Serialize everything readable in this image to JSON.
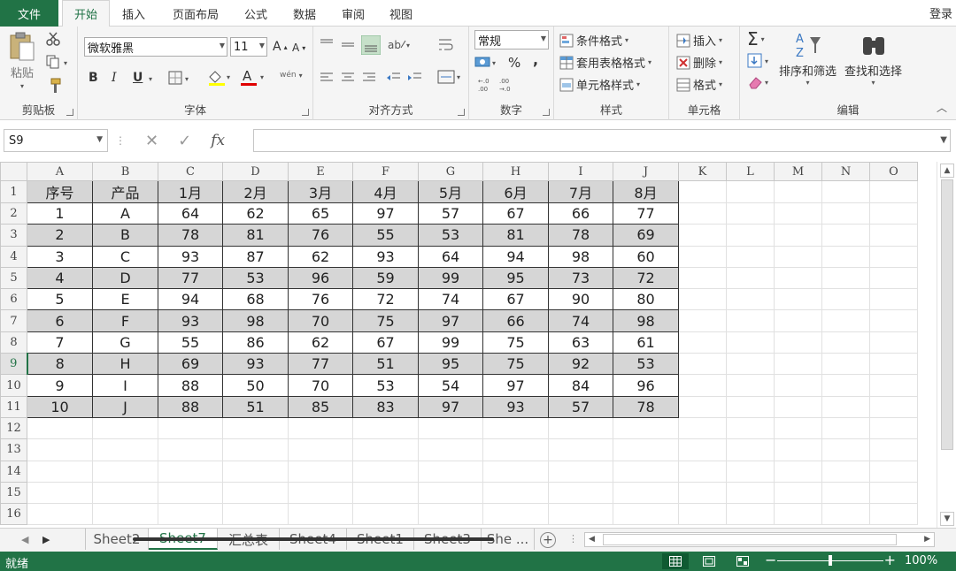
{
  "tabs": {
    "file": "文件",
    "items": [
      "开始",
      "插入",
      "页面布局",
      "公式",
      "数据",
      "审阅",
      "视图"
    ],
    "active": "开始",
    "login": "登录"
  },
  "ribbon": {
    "clipboard": {
      "label": "剪贴板",
      "paste": "粘贴"
    },
    "font": {
      "label": "字体",
      "name": "微软雅黑",
      "size": "11",
      "bold": "B",
      "italic": "I",
      "underline": "U",
      "grow": "A",
      "shrink": "A",
      "phonetic": "wén"
    },
    "alignment": {
      "label": "对齐方式"
    },
    "number": {
      "label": "数字",
      "format": "常规",
      "percent": "%",
      "comma": ","
    },
    "styles": {
      "label": "样式",
      "conditional": "条件格式",
      "table": "套用表格格式",
      "cell_styles": "单元格样式"
    },
    "cells": {
      "label": "单元格",
      "insert": "插入",
      "delete": "删除",
      "format": "格式"
    },
    "editing": {
      "label": "编辑",
      "sort_filter": "排序和筛选",
      "find_select": "查找和选择",
      "sigma": "Σ"
    },
    "accent": "#217346"
  },
  "formula_bar": {
    "name_box": "S9",
    "fx": "fx",
    "formula": ""
  },
  "grid": {
    "columns": [
      "A",
      "B",
      "C",
      "D",
      "E",
      "F",
      "G",
      "H",
      "I",
      "J",
      "K",
      "L",
      "M",
      "N",
      "O"
    ],
    "row_numbers": [
      "1",
      "2",
      "3",
      "4",
      "5",
      "6",
      "7",
      "8",
      "9",
      "10",
      "11",
      "12",
      "13",
      "14",
      "15",
      "16"
    ],
    "selected_row": "9",
    "header": [
      "序号",
      "产品",
      "1月",
      "2月",
      "3月",
      "4月",
      "5月",
      "6月",
      "7月",
      "8月"
    ],
    "rows": [
      [
        "1",
        "A",
        "64",
        "62",
        "65",
        "97",
        "57",
        "67",
        "66",
        "77"
      ],
      [
        "2",
        "B",
        "78",
        "81",
        "76",
        "55",
        "53",
        "81",
        "78",
        "69"
      ],
      [
        "3",
        "C",
        "93",
        "87",
        "62",
        "93",
        "64",
        "94",
        "98",
        "60"
      ],
      [
        "4",
        "D",
        "77",
        "53",
        "96",
        "59",
        "99",
        "95",
        "73",
        "72"
      ],
      [
        "5",
        "E",
        "94",
        "68",
        "76",
        "72",
        "74",
        "67",
        "90",
        "80"
      ],
      [
        "6",
        "F",
        "93",
        "98",
        "70",
        "75",
        "97",
        "66",
        "74",
        "98"
      ],
      [
        "7",
        "G",
        "55",
        "86",
        "62",
        "67",
        "99",
        "75",
        "63",
        "61"
      ],
      [
        "8",
        "H",
        "69",
        "93",
        "77",
        "51",
        "95",
        "75",
        "92",
        "53"
      ],
      [
        "9",
        "I",
        "88",
        "50",
        "70",
        "53",
        "54",
        "97",
        "84",
        "96"
      ],
      [
        "10",
        "J",
        "88",
        "51",
        "85",
        "83",
        "97",
        "93",
        "57",
        "78"
      ]
    ],
    "shaded_color": "#d6d6d6"
  },
  "sheet_tabs": {
    "items": [
      "Sheet2",
      "Sheet7",
      "汇总表",
      "Sheet4",
      "Sheet1",
      "Sheet3",
      "She ..."
    ],
    "active": "Sheet7"
  },
  "status": {
    "ready": "就绪",
    "zoom": "100%",
    "zoom_level": 0.5
  }
}
